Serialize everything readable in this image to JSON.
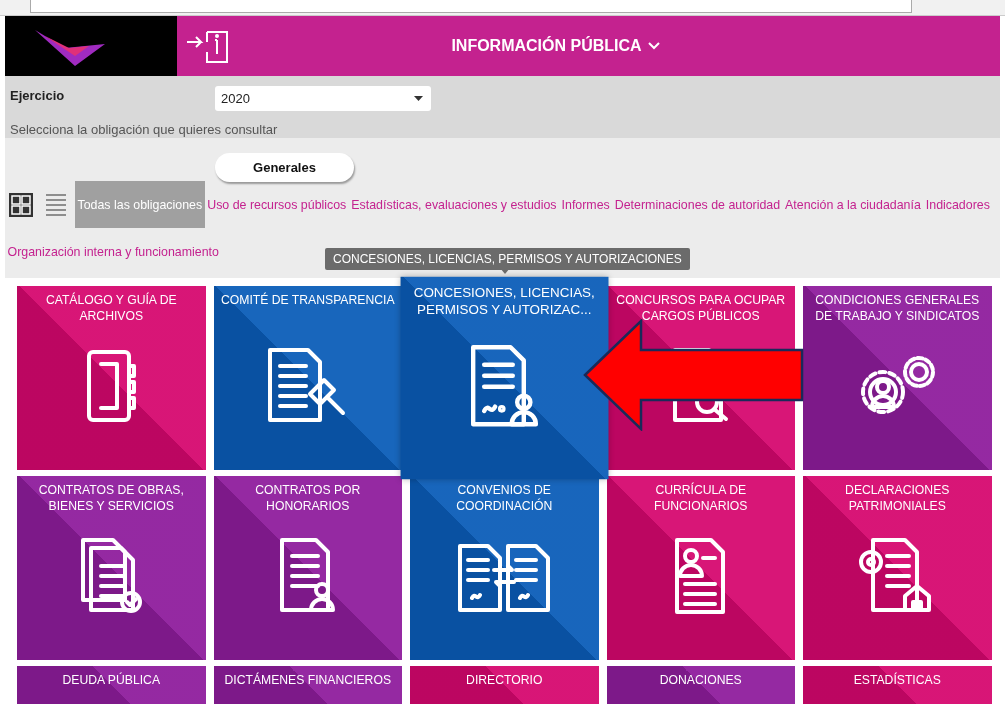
{
  "header": {
    "title": "INFORMACIÓN PÚBLICA"
  },
  "filter": {
    "label": "Ejercicio",
    "value": "2020",
    "hint": "Selecciona la obligación que quieres consultar"
  },
  "section_button": "Generales",
  "views": [
    {
      "kind": "grid",
      "selected": true
    },
    {
      "kind": "list",
      "selected": false
    }
  ],
  "tabs": [
    {
      "label": "Todas las obligaciones",
      "selected": true
    },
    {
      "label": "Uso de recursos públicos",
      "selected": false
    },
    {
      "label": "Estadísticas, evaluaciones y estudios",
      "selected": false
    },
    {
      "label": "Informes",
      "selected": false
    },
    {
      "label": "Determinaciones de autoridad",
      "selected": false
    },
    {
      "label": "Atención a la ciudadanía",
      "selected": false
    },
    {
      "label": "Indicadores",
      "selected": false
    },
    {
      "label": "Organización interna y funcionamiento",
      "selected": false
    }
  ],
  "tooltip": "CONCESIONES, LICENCIAS, PERMISOS Y AUTORIZACIONES",
  "annotation_arrow": true,
  "tiles": [
    {
      "title": "CATÁLOGO Y GUÍA DE ARCHIVOS",
      "color": "#d6076e",
      "kind": "binder",
      "selected": false
    },
    {
      "title": "COMITÉ DE TRANSPARENCIA",
      "color": "#0a5cb8",
      "kind": "gavel",
      "selected": false
    },
    {
      "title": "CONCESIONES, LICENCIAS, PERMISOS Y AUTORIZAC...",
      "color": "#0a5cb8",
      "kind": "signed",
      "selected": true
    },
    {
      "title": "CONCURSOS PARA OCUPAR CARGOS PÚBLICOS",
      "color": "#d6076e",
      "kind": "search",
      "selected": false
    },
    {
      "title": "CONDICIONES GENERALES DE TRABAJO Y SINDICATOS",
      "color": "#8e1c9c",
      "kind": "gears",
      "selected": false
    },
    {
      "title": "CONTRATOS DE OBRAS, BIENES Y SERVICIOS",
      "color": "#8e1c9c",
      "kind": "stack",
      "selected": false
    },
    {
      "title": "CONTRATOS POR HONORARIOS",
      "color": "#8e1c9c",
      "kind": "person",
      "selected": false
    },
    {
      "title": "CONVENIOS DE COORDINACIÓN",
      "color": "#0a5cb8",
      "kind": "exchange",
      "selected": false
    },
    {
      "title": "CURRÍCULA DE FUNCIONARIOS",
      "color": "#d6076e",
      "kind": "resume",
      "selected": false
    },
    {
      "title": "DECLARACIONES PATRIMONIALES",
      "color": "#d6076e",
      "kind": "house",
      "selected": false
    },
    {
      "title": "DEUDA PÚBLICA",
      "color": "#8e1c9c",
      "selected": false
    },
    {
      "title": "DICTÁMENES FINANCIEROS",
      "color": "#8e1c9c",
      "selected": false
    },
    {
      "title": "DIRECTORIO",
      "color": "#d6076e",
      "selected": false
    },
    {
      "title": "DONACIONES",
      "color": "#8e1c9c",
      "selected": false
    },
    {
      "title": "ESTADÍSTICAS",
      "color": "#d6076e",
      "selected": false
    }
  ]
}
